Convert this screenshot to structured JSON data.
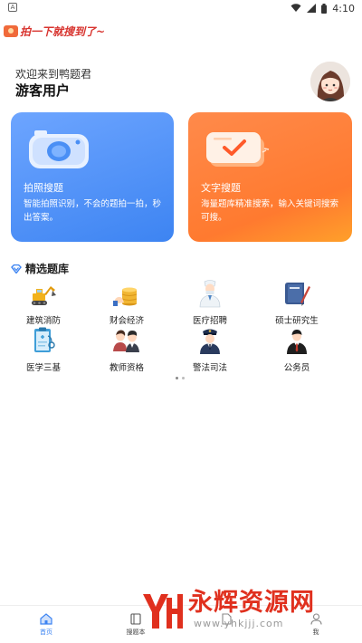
{
  "status_bar": {
    "time": "4:10"
  },
  "app": {
    "logo_text": "拍一下就搜到了~"
  },
  "greeting": {
    "welcome": "欢迎来到鸭题君",
    "user_name": "游客用户"
  },
  "cards": [
    {
      "title": "拍照搜题",
      "desc": "智能拍照识别，不会的题拍一拍，秒出答案。",
      "icon": "camera-icon"
    },
    {
      "title": "文字搜题",
      "desc": "海量题库精准搜索，输入关键词搜索可搜。",
      "icon": "checkmark-card-icon"
    }
  ],
  "section": {
    "title": "精选题库"
  },
  "categories": [
    {
      "label": "建筑消防",
      "icon": "excavator-icon"
    },
    {
      "label": "财会经济",
      "icon": "coins-icon"
    },
    {
      "label": "医疗招聘",
      "icon": "doctor-icon"
    },
    {
      "label": "硕士研究生",
      "icon": "book-icon"
    },
    {
      "label": "医学三基",
      "icon": "clipboard-icon"
    },
    {
      "label": "教师资格",
      "icon": "teachers-icon"
    },
    {
      "label": "警法司法",
      "icon": "police-icon"
    },
    {
      "label": "公务员",
      "icon": "civil-servant-icon"
    }
  ],
  "bottom_nav": [
    {
      "label": "首页",
      "icon": "home-icon",
      "active": true
    },
    {
      "label": "搜题本",
      "icon": "notebook-icon",
      "active": false
    },
    {
      "label": "",
      "icon": "doc-icon",
      "active": false
    },
    {
      "label": "我",
      "icon": "user-icon",
      "active": false
    }
  ],
  "watermark": {
    "text": "永辉资源网",
    "url": "www.yhkjjj.com"
  },
  "colors": {
    "accent_blue": "#3d84f2",
    "accent_orange": "#ff7a2f",
    "watermark_red": "#e0301e"
  }
}
